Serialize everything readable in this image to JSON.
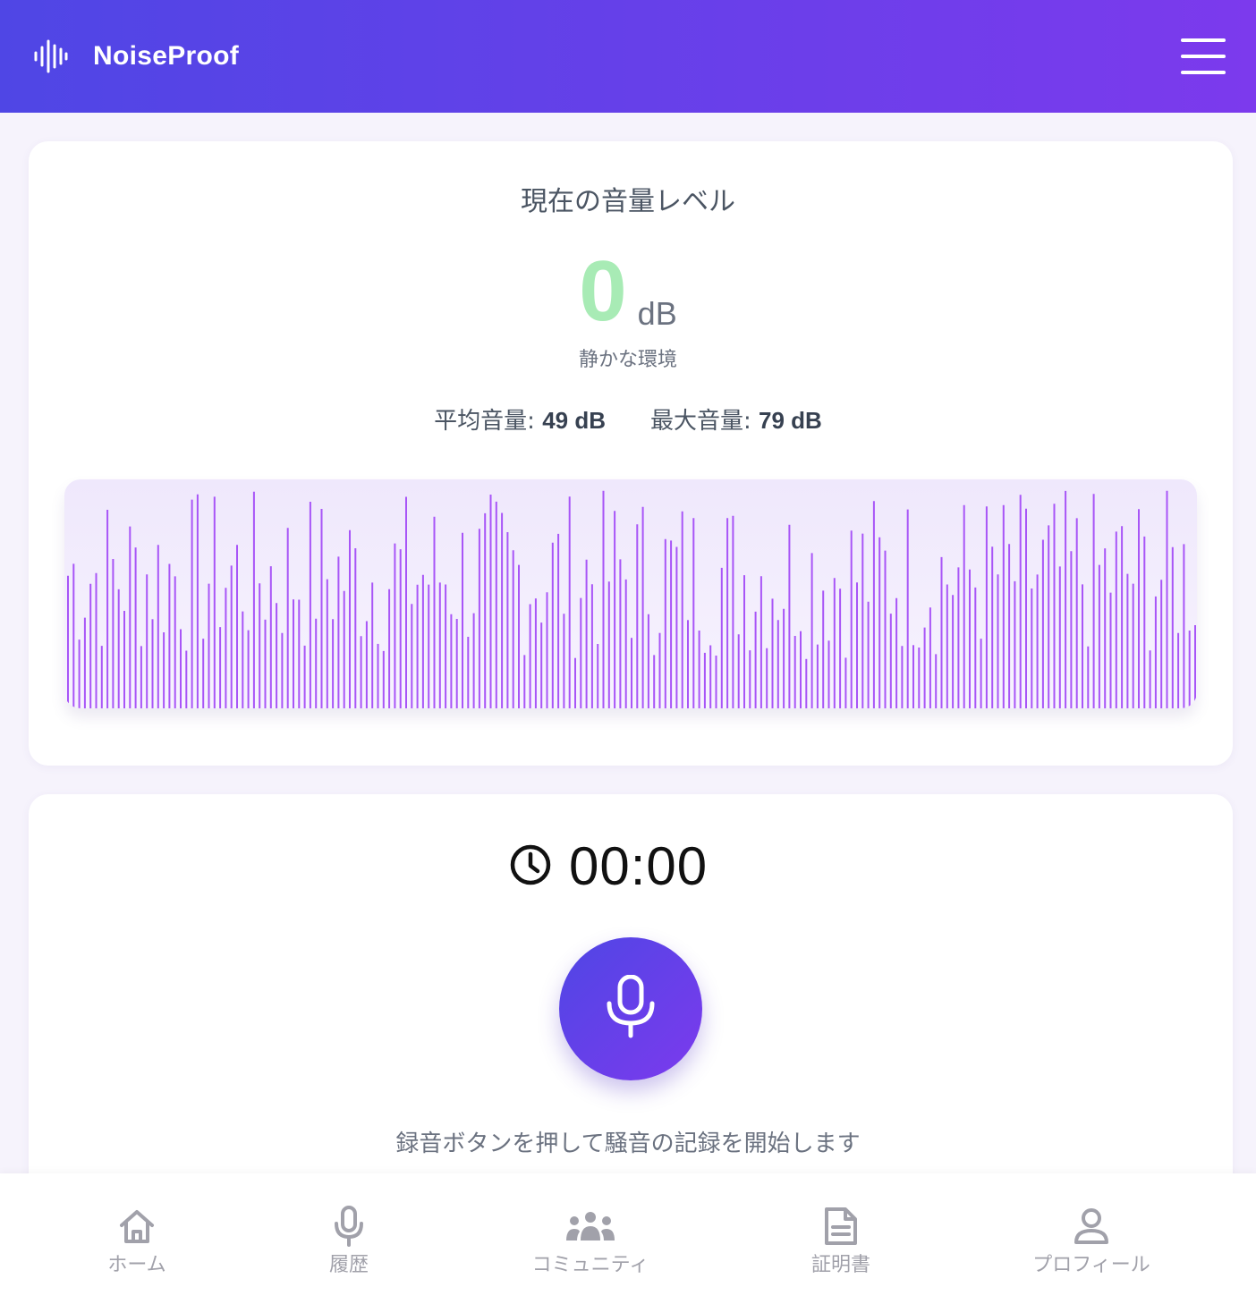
{
  "header": {
    "brand_name": "NoiseProof",
    "brand_icon": "sound-wave-icon",
    "menu_icon": "hamburger-menu-icon",
    "colors": {
      "gradient_start": "#4f46e5",
      "gradient_end": "#7c3aed"
    }
  },
  "level": {
    "title": "現在の音量レベル",
    "value": "0",
    "unit": "dB",
    "status": "静かな環境",
    "average_label": "平均音量:",
    "average_value": "49 dB",
    "max_label": "最大音量:",
    "max_value": "79 dB",
    "value_color": "#a8ebb5",
    "wave_color": "#a855f7"
  },
  "recorder": {
    "timer_icon": "clock-icon",
    "timer": "00:00",
    "mic_icon": "microphone-icon",
    "hint": "録音ボタンを押して騒音の記録を開始します"
  },
  "nav": {
    "items": [
      {
        "label": "ホーム",
        "icon": "home-icon"
      },
      {
        "label": "履歴",
        "icon": "microphone-icon"
      },
      {
        "label": "コミュニティ",
        "icon": "users-icon"
      },
      {
        "label": "証明書",
        "icon": "document-icon"
      },
      {
        "label": "プロフィール",
        "icon": "user-icon"
      }
    ]
  }
}
